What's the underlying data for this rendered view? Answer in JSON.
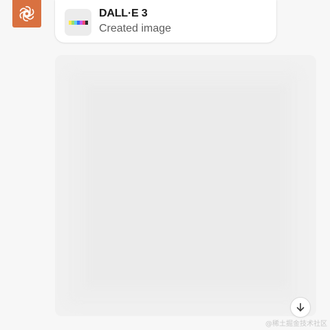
{
  "colors": {
    "assistant_avatar_bg": "#d97140",
    "card_bg": "#ffffff",
    "thumb_bg": "#ececec",
    "title_text": "#1a1a1a",
    "subtitle_text": "#5d5d5d",
    "placeholder_bg": "#f1f1f1"
  },
  "assistant": {
    "avatar_icon": "openai-logo-icon"
  },
  "tool_card": {
    "title": "DALL·E 3",
    "subtitle": "Created image",
    "thumb_icon": "dalle-palette-icon",
    "palette_colors": [
      "#ffe84d",
      "#9be06a",
      "#5fd0f0",
      "#3a6ef5",
      "#c25cf0",
      "#f04a7a",
      "#2b2b2b"
    ]
  },
  "generated_image": {
    "state": "loading-placeholder"
  },
  "scroll_to_bottom": {
    "icon": "arrow-down-icon"
  },
  "watermark": {
    "text": "@稀土掘金技术社区"
  }
}
